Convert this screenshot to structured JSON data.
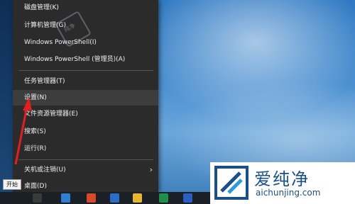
{
  "context_menu": {
    "items": [
      {
        "label": "磁盘管理(K)"
      },
      {
        "label": "计算机管理(G)"
      },
      {
        "label": "Windows PowerShell(I)"
      },
      {
        "label": "Windows PowerShell (管理员)(A)"
      },
      {
        "label": "任务管理器(T)"
      },
      {
        "label": "设置(N)"
      },
      {
        "label": "文件资源管理器(E)"
      },
      {
        "label": "搜索(S)"
      },
      {
        "label": "运行(R)"
      },
      {
        "label": "关机或注销(U)"
      },
      {
        "label": "桌面(D)"
      }
    ]
  },
  "tooltip": {
    "label": "开始"
  },
  "watermark": {
    "title": "爱纯净",
    "url": "aichunjing.com",
    "small_text": "纯净"
  },
  "colors": {
    "menu_bg": "#2b2b2b",
    "arrow": "#e02020",
    "brand": "#1b4f8a"
  },
  "icons": {
    "submenu": "chevron-right-icon"
  }
}
